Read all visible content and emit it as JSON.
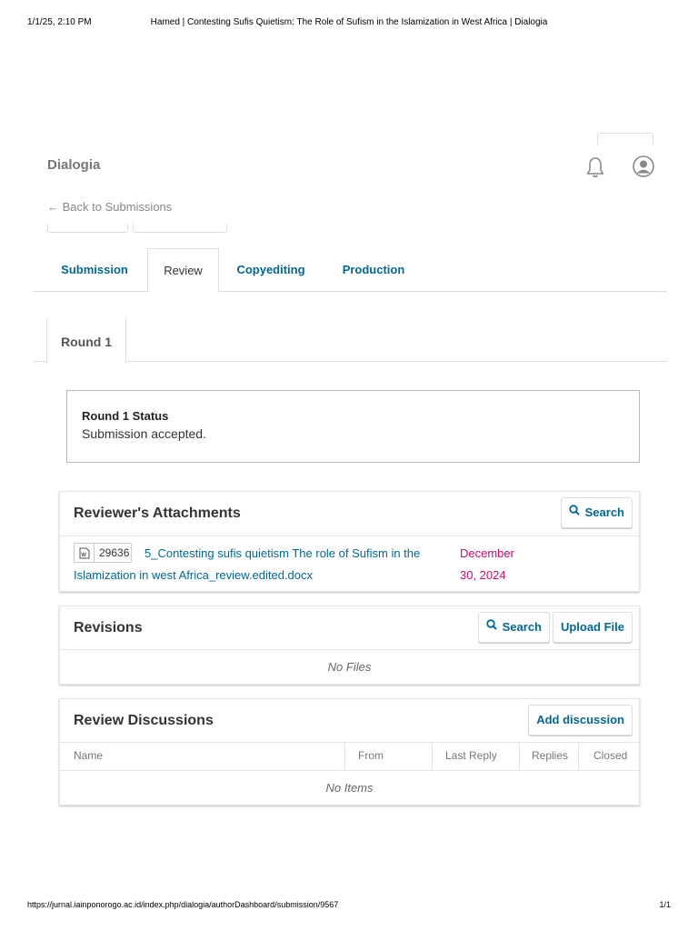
{
  "print_header": {
    "date": "1/1/25, 2:10 PM",
    "title": "Hamed | Contesting Sufis Quietism: The Role of Sufism in the Islamization in West Africa | Dialogia"
  },
  "print_footer": {
    "url": "https://jurnal.iainponorogo.ac.id/index.php/dialogia/authorDashboard/submission/9567",
    "pages": "1/1"
  },
  "header": {
    "app_name": "Dialogia",
    "back_link": "← Back to Submissions",
    "icons": [
      "bell-icon",
      "user-icon"
    ]
  },
  "tabs": [
    {
      "label": "Submission",
      "active": false
    },
    {
      "label": "Review",
      "active": true
    },
    {
      "label": "Copyediting",
      "active": false
    },
    {
      "label": "Production",
      "active": false
    }
  ],
  "round": {
    "tab_label": "Round 1",
    "status_heading": "Round 1 Status",
    "status_text": "Submission accepted."
  },
  "reviewer_attachments": {
    "title": "Reviewer's Attachments",
    "search_label": "Search",
    "file": {
      "id": "29636",
      "name": "5_Contesting sufis quietism The role of Sufism in the Islamization in west Africa_review.edited.docx",
      "date": "December 30, 2024",
      "icon": "word-doc-icon"
    }
  },
  "revisions": {
    "title": "Revisions",
    "search_label": "Search",
    "upload_label": "Upload File",
    "empty_text": "No Files"
  },
  "review_discussions": {
    "title": "Review Discussions",
    "add_label": "Add discussion",
    "columns": [
      "Name",
      "From",
      "Last Reply",
      "Replies",
      "Closed"
    ],
    "empty_text": "No Items"
  },
  "colors": {
    "link": "#006798",
    "date": "#d00a6c",
    "border": "#dddddd"
  }
}
